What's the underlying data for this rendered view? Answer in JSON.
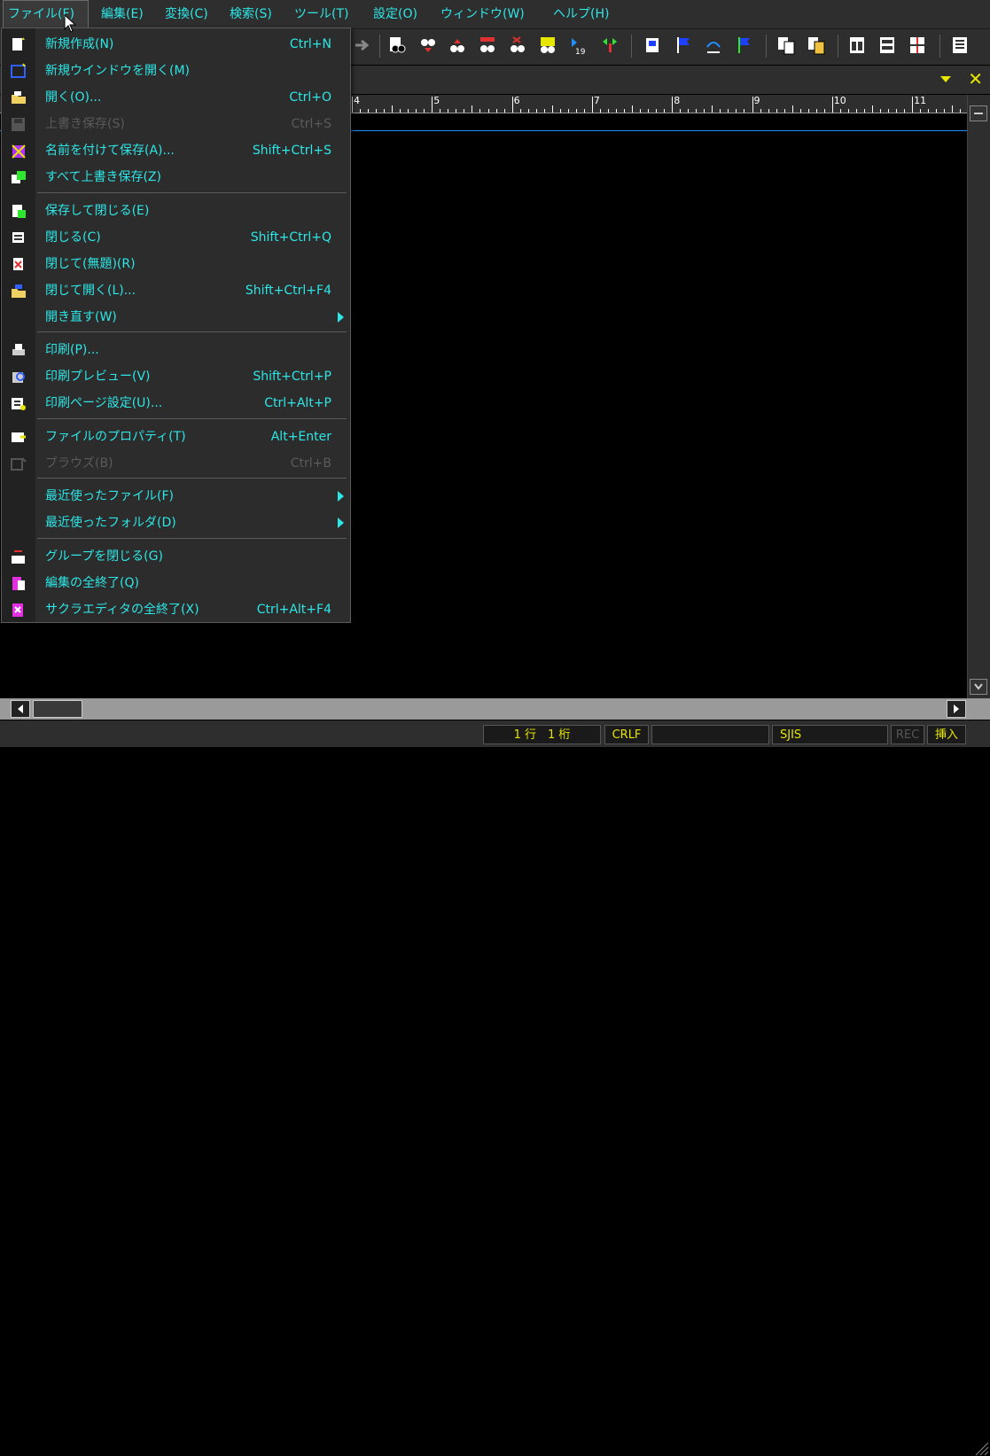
{
  "menubar": {
    "items": [
      {
        "label": "ファイル(F)",
        "active": true
      },
      {
        "label": "編集(E)"
      },
      {
        "label": "変換(C)"
      },
      {
        "label": "検索(S)"
      },
      {
        "label": "ツール(T)"
      },
      {
        "label": "設定(O)"
      },
      {
        "label": "ウィンドウ(W)"
      },
      {
        "label": "ヘルプ(H)"
      }
    ]
  },
  "file_menu": {
    "items": [
      {
        "label": "新規作成(N)",
        "shortcut": "Ctrl+N",
        "icon": "new-file-icon"
      },
      {
        "label": "新規ウインドウを開く(M)",
        "shortcut": "",
        "icon": "new-window-icon"
      },
      {
        "label": "開く(O)...",
        "shortcut": "Ctrl+O",
        "icon": "open-folder-icon"
      },
      {
        "label": "上書き保存(S)",
        "shortcut": "Ctrl+S",
        "icon": "save-icon",
        "disabled": true
      },
      {
        "label": "名前を付けて保存(A)...",
        "shortcut": "Shift+Ctrl+S",
        "icon": "save-as-icon"
      },
      {
        "label": "すべて上書き保存(Z)",
        "shortcut": "",
        "icon": "save-all-icon"
      },
      {
        "label": "保存して閉じる(E)",
        "shortcut": "",
        "icon": "save-close-icon"
      },
      {
        "label": "閉じる(C)",
        "shortcut": "Shift+Ctrl+Q",
        "icon": "close-doc-icon"
      },
      {
        "label": "閉じて(無題)(R)",
        "shortcut": "",
        "icon": "close-untitled-icon"
      },
      {
        "label": "閉じて開く(L)...",
        "shortcut": "Shift+Ctrl+F4",
        "icon": "close-open-icon"
      },
      {
        "label": "開き直す(W)",
        "shortcut": "",
        "icon": "",
        "submenu": true
      },
      {
        "label": "印刷(P)...",
        "shortcut": "",
        "icon": "print-icon"
      },
      {
        "label": "印刷プレビュー(V)",
        "shortcut": "Shift+Ctrl+P",
        "icon": "print-preview-icon"
      },
      {
        "label": "印刷ページ設定(U)...",
        "shortcut": "Ctrl+Alt+P",
        "icon": "page-setup-icon"
      },
      {
        "label": "ファイルのプロパティ(T)",
        "shortcut": "Alt+Enter",
        "icon": "file-properties-icon"
      },
      {
        "label": "ブラウズ(B)",
        "shortcut": "Ctrl+B",
        "icon": "browse-icon",
        "disabled": true
      },
      {
        "label": "最近使ったファイル(F)",
        "shortcut": "",
        "icon": "",
        "submenu": true
      },
      {
        "label": "最近使ったフォルダ(D)",
        "shortcut": "",
        "icon": "",
        "submenu": true
      },
      {
        "label": "グループを閉じる(G)",
        "shortcut": "",
        "icon": "close-group-icon"
      },
      {
        "label": "編集の全終了(Q)",
        "shortcut": "",
        "icon": "exit-edit-icon"
      },
      {
        "label": "サクラエディタの全終了(X)",
        "shortcut": "Ctrl+Alt+F4",
        "icon": "exit-app-icon"
      }
    ]
  },
  "ruler": {
    "labels": [
      "4",
      "5",
      "6",
      "7",
      "8",
      "9",
      "10",
      "11"
    ]
  },
  "status": {
    "position": "1 行　1 桁",
    "line_ending": "CRLF",
    "blank": "",
    "encoding": "SJIS",
    "rec": "REC",
    "mode": "挿入"
  },
  "colors": {
    "accent": "#2ee6e6",
    "status_text": "#e6e600",
    "cursor_line": "#1e90ff"
  }
}
